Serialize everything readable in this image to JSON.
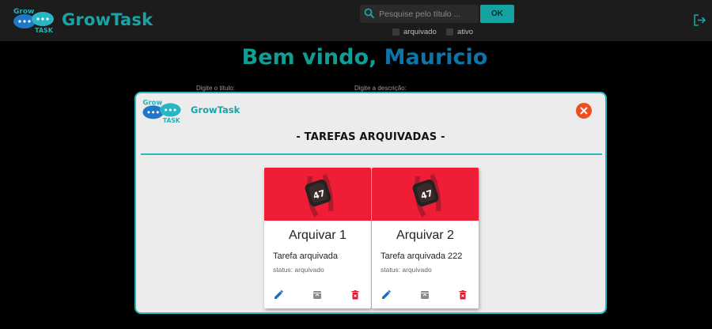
{
  "app": {
    "brand": "GrowTask",
    "logo_text": "Grow TASK"
  },
  "search": {
    "placeholder": "Pesquise pelo título ...",
    "ok_label": "OK",
    "filters": [
      {
        "label": "arquivado",
        "checked": false
      },
      {
        "label": "ativo",
        "checked": false
      }
    ]
  },
  "welcome": {
    "greeting": "Bem vindo,",
    "name": "Mauricio"
  },
  "form": {
    "title_label": "Digite o título:",
    "description_label": "Digite a descrição:"
  },
  "modal": {
    "brand": "GrowTask",
    "title": "- TAREFAS ARQUIVADAS -",
    "cards": [
      {
        "title": "Arquivar 1",
        "description": "Tarefa arquivada",
        "status": "status: arquivado"
      },
      {
        "title": "Arquivar 2",
        "description": "Tarefa arquivada 222",
        "status": "status: arquivado"
      }
    ]
  },
  "colors": {
    "accent": "#14a3a1",
    "close": "#f04d1f",
    "card_image_bg": "#ef1d36",
    "edit_icon": "#1f6fc4",
    "delete_icon": "#e0162b"
  },
  "icons": [
    "search-icon",
    "logout-icon",
    "close-icon",
    "smartwatch-icon",
    "edit-icon",
    "unarchive-icon",
    "delete-icon"
  ]
}
